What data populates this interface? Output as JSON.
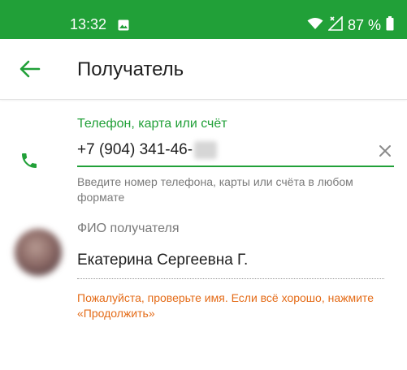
{
  "status_bar": {
    "time": "13:32",
    "battery_percent": "87 %",
    "icons": [
      "gallery-icon",
      "wifi-icon",
      "signal-x-icon",
      "battery-icon"
    ]
  },
  "app_bar": {
    "title": "Получатель"
  },
  "recipient_field": {
    "label": "Телефон, карта или счёт",
    "value": "+7 (904) 341-46-",
    "hint": "Введите номер телефона, карты или счёта в любом формате"
  },
  "name_field": {
    "label": "ФИО получателя",
    "value": "Екатерина Сергеевна Г.",
    "warning": "Пожалуйста, проверьте имя. Если всё хорошо, нажмите «Продолжить»"
  },
  "colors": {
    "brand_green": "#21a038",
    "warning_orange": "#e46b17",
    "text_primary": "#1f1f1f",
    "text_secondary": "#7a7a7a"
  }
}
